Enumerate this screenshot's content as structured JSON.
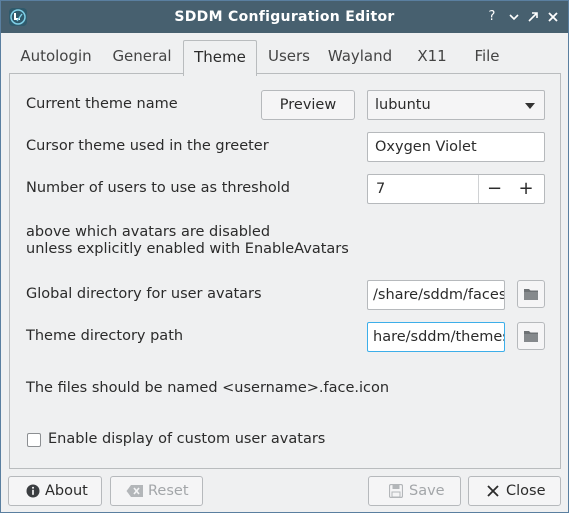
{
  "window": {
    "title": "SDDM Configuration Editor",
    "app_icon": "lubuntu-logo-icon",
    "controls": {
      "help": "?",
      "minimize": "⌄",
      "maximize": "⌃",
      "close": "✕"
    }
  },
  "tabs": [
    {
      "label": "Autologin",
      "active": false
    },
    {
      "label": "General",
      "active": false
    },
    {
      "label": "Theme",
      "active": true
    },
    {
      "label": "Users",
      "active": false
    },
    {
      "label": "Wayland",
      "active": false
    },
    {
      "label": "X11",
      "active": false
    },
    {
      "label": "File",
      "active": false
    }
  ],
  "theme": {
    "current_theme_label": "Current theme name",
    "preview_button": "Preview",
    "current_theme_value": "lubuntu",
    "cursor_theme_label": "Cursor theme used in the greeter",
    "cursor_theme_value": "Oxygen Violet",
    "threshold_label": "Number of users to use as threshold",
    "threshold_value": "7",
    "spin_minus": "−",
    "spin_plus": "+",
    "threshold_help_line1": "above which avatars are disabled",
    "threshold_help_line2": "unless explicitly enabled with EnableAvatars",
    "global_dir_label": "Global directory for user avatars",
    "global_dir_value": "/share/sddm/faces",
    "theme_dir_label": "Theme directory path",
    "theme_dir_value": "hare/sddm/themes",
    "files_note": "The files should be named <username>.face.icon",
    "enable_avatars_label": "Enable display of custom user avatars",
    "enable_avatars_checked": false
  },
  "footer": {
    "about": "About",
    "reset": "Reset",
    "save": "Save",
    "close": "Close",
    "reset_enabled": false,
    "save_enabled": false
  },
  "colors": {
    "titlebar": "#47606f",
    "window_bg": "#eff0f1",
    "border": "#b9bcbe"
  }
}
